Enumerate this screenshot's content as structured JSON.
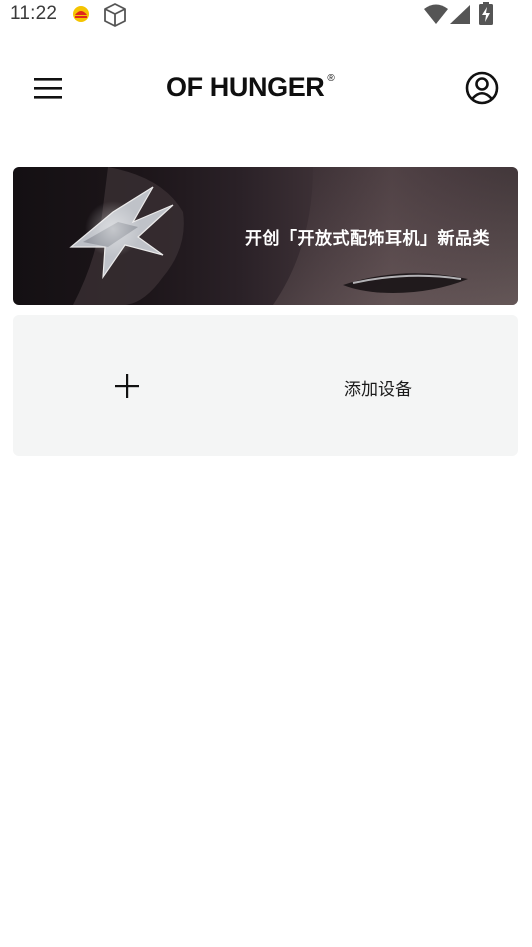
{
  "status_bar": {
    "time": "11:22",
    "icons": [
      "app-notification-icon",
      "package-box-icon",
      "wifi-icon",
      "cell-signal-icon",
      "battery-charging-icon"
    ]
  },
  "header": {
    "brand": "OF HUNGER",
    "brand_mark": "®",
    "icons": [
      "hamburger-menu-icon",
      "account-circle-icon"
    ]
  },
  "banner": {
    "text": "开创「开放式配饰耳机」新品类"
  },
  "add_device": {
    "label": "添加设备",
    "icon": "plus-icon"
  },
  "colors": {
    "background": "#ffffff",
    "card": "#f4f5f5",
    "text": "#1a1a1a",
    "banner_text": "#ffffff"
  }
}
